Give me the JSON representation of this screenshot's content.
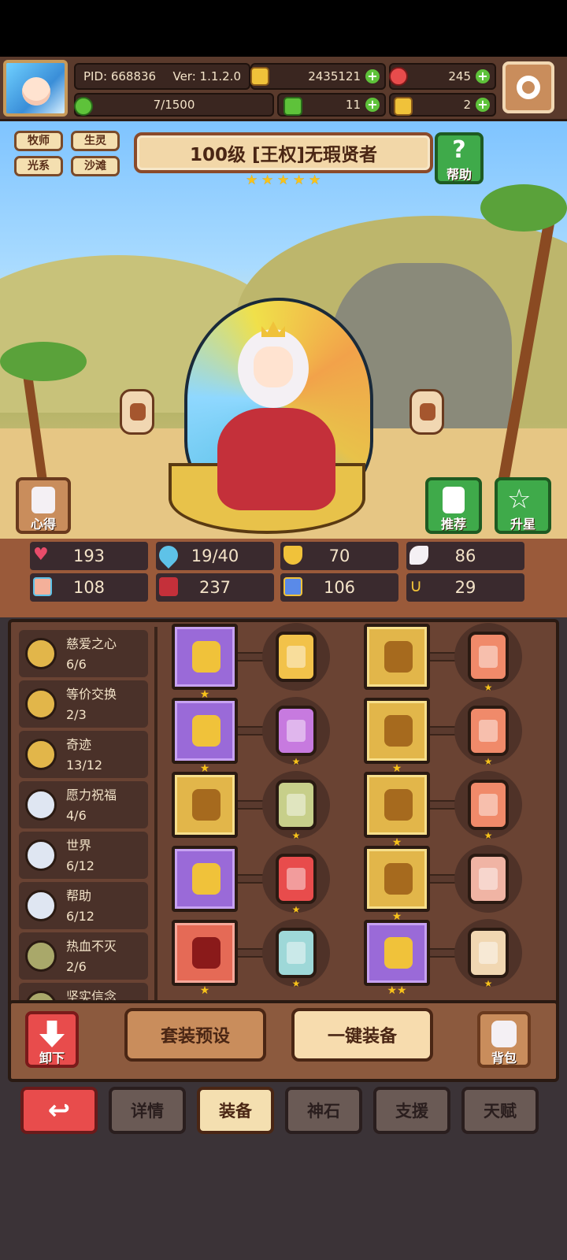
{
  "header": {
    "pid": "PID: 668836",
    "version": "Ver: 1.1.2.0",
    "gold": "2435121",
    "gems": "245",
    "xp": "7/1500",
    "clover": "11",
    "horn": "2"
  },
  "tags": [
    "牧师",
    "生灵",
    "光系",
    "沙滩"
  ],
  "hero": {
    "title": "100级 [王权]无瑕贤者",
    "stars": 5,
    "help_label": "帮助",
    "xinde_label": "心得",
    "recommend_label": "推荐",
    "upgrade_label": "升星"
  },
  "stats": {
    "hp": "193",
    "mana": "19/40",
    "defense": "70",
    "speed": "86",
    "attack": "108",
    "magic": "237",
    "crit": "106",
    "luck": "29"
  },
  "sets": [
    {
      "name": "慈爱之心",
      "count": "6/6",
      "color": "#e2b64a"
    },
    {
      "name": "等价交换",
      "count": "2/3",
      "color": "#e2b64a"
    },
    {
      "name": "奇迹",
      "count": "13/12",
      "color": "#e2b64a"
    },
    {
      "name": "愿力祝福",
      "count": "4/6",
      "color": "#dfe6f2"
    },
    {
      "name": "世界",
      "count": "6/12",
      "color": "#dfe6f2"
    },
    {
      "name": "帮助",
      "count": "6/12",
      "color": "#dfe6f2"
    },
    {
      "name": "热血不灭",
      "count": "2/6",
      "color": "#a9a86a"
    },
    {
      "name": "坚实信念",
      "count": "",
      "color": "#a9a86a"
    }
  ],
  "equipment": {
    "left_slots": [
      {
        "rarity": "purple",
        "stars": "★",
        "item": "scepter-icon"
      },
      {
        "rarity": "purple",
        "stars": "★",
        "item": "shield-icon"
      },
      {
        "rarity": "gold",
        "stars": "",
        "item": "mask-icon"
      },
      {
        "rarity": "purple",
        "stars": "",
        "item": "cross-icon"
      },
      {
        "rarity": "red",
        "stars": "★",
        "item": "helmet-icon"
      }
    ],
    "left_gems": [
      {
        "color": "#f2c24a",
        "stars": ""
      },
      {
        "color": "#c77adf",
        "stars": "★"
      },
      {
        "color": "#c7cf8a",
        "stars": "★"
      },
      {
        "color": "#e84c4c",
        "stars": "★"
      },
      {
        "color": "#9ed8d8",
        "stars": "★"
      }
    ],
    "right_slots": [
      {
        "rarity": "gold",
        "stars": "",
        "item": "necklace-icon"
      },
      {
        "rarity": "gold",
        "stars": "★",
        "item": "armor-icon"
      },
      {
        "rarity": "gold",
        "stars": "★",
        "item": "scroll-icon"
      },
      {
        "rarity": "gold",
        "stars": "★",
        "item": "bowl-icon"
      },
      {
        "rarity": "purple",
        "stars": "★★",
        "item": "boots-icon"
      }
    ],
    "right_gems": [
      {
        "color": "#f08a6a",
        "stars": "★"
      },
      {
        "color": "#f08a6a",
        "stars": "★"
      },
      {
        "color": "#f08a6a",
        "stars": "★"
      },
      {
        "color": "#f0b4a4",
        "stars": ""
      },
      {
        "color": "#f1d7b2",
        "stars": "★"
      }
    ]
  },
  "actions": {
    "unequip": "卸下",
    "preset": "套装预设",
    "equip_all": "一键装备",
    "bag": "背包"
  },
  "tabs": [
    "详情",
    "装备",
    "神石",
    "支援",
    "天赋"
  ],
  "active_tab": 1
}
